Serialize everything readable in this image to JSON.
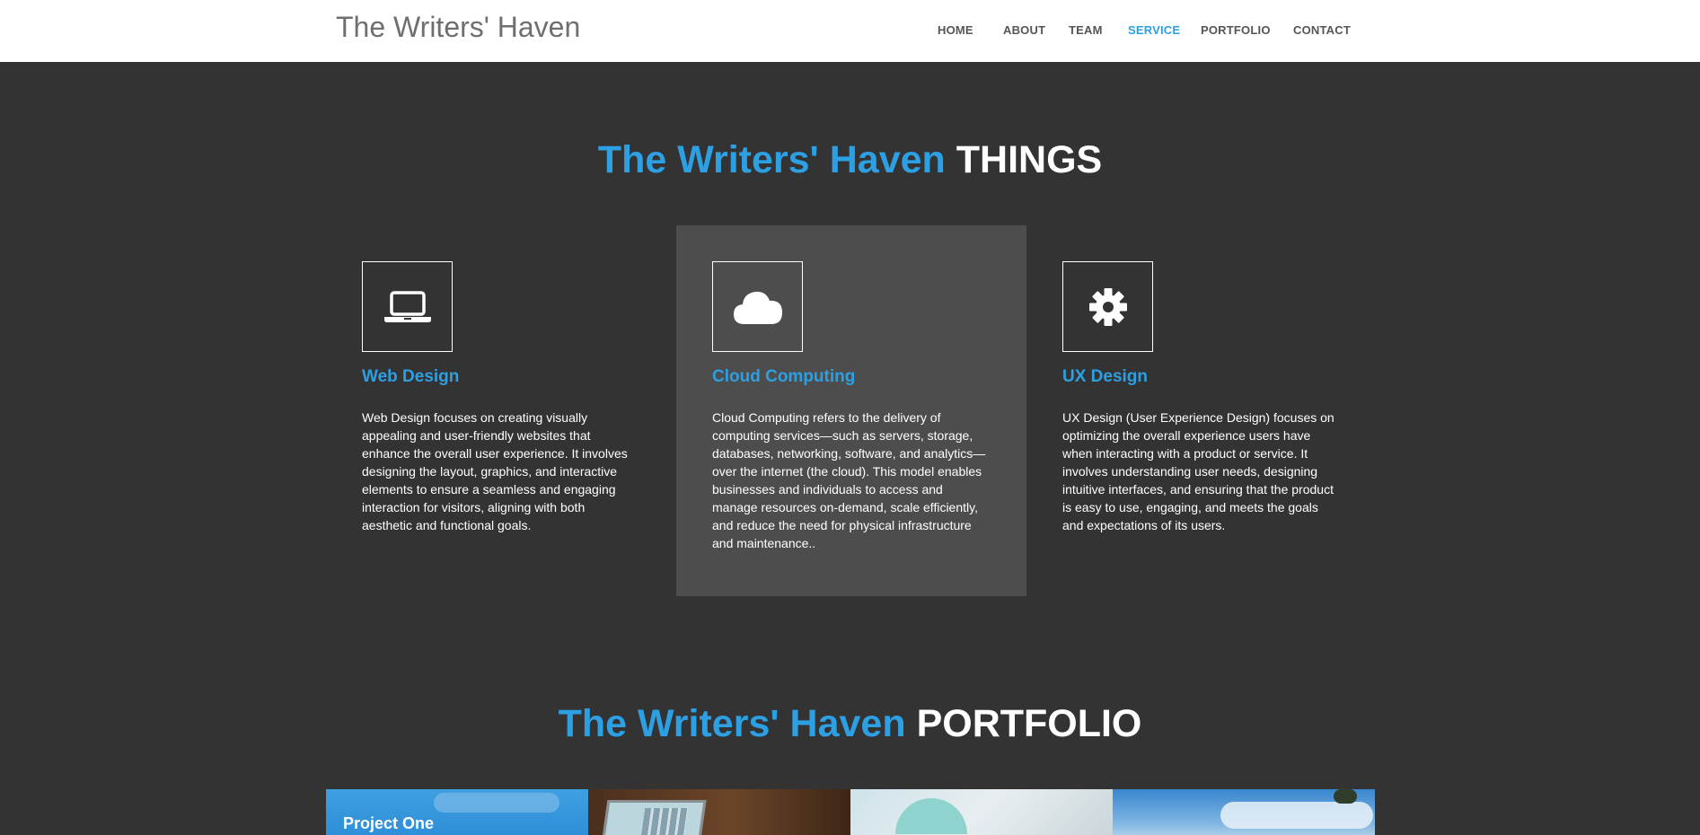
{
  "header": {
    "brand": "The Writers' Haven",
    "nav": [
      {
        "label": "HOME"
      },
      {
        "label": "ABOUT"
      },
      {
        "label": "TEAM"
      },
      {
        "label": "SERVICE",
        "active": true
      },
      {
        "label": "PORTFOLIO"
      },
      {
        "label": "CONTACT"
      }
    ]
  },
  "services": {
    "title_accent": "The Writers' Haven",
    "title_rest": "THINGS",
    "items": [
      {
        "icon": "laptop-icon",
        "title": "Web Design",
        "text": "Web Design focuses on creating visually appealing and user-friendly websites that enhance the overall user experience. It involves designing the layout, graphics, and interactive elements to ensure a seamless and engaging interaction for visitors, aligning with both aesthetic and functional goals."
      },
      {
        "icon": "cloud-icon",
        "title": "Cloud Computing",
        "text": "Cloud Computing refers to the delivery of computing services—such as servers, storage, databases, networking, software, and analytics—over the internet (the cloud). This model enables businesses and individuals to access and manage resources on-demand, scale efficiently, and reduce the need for physical infrastructure and maintenance.."
      },
      {
        "icon": "gear-icon",
        "title": "UX Design",
        "text": "UX Design (User Experience Design) focuses on optimizing the overall experience users have when interacting with a product or service. It involves understanding user needs, designing intuitive interfaces, and ensuring that the product is easy to use, engaging, and meets the goals and expectations of its users."
      }
    ]
  },
  "portfolio": {
    "title_accent": "The Writers' Haven",
    "title_rest": "PORTFOLIO",
    "items": [
      {
        "label": "Project One"
      },
      {
        "label": ""
      },
      {
        "label": ""
      },
      {
        "label": ""
      }
    ]
  },
  "colors": {
    "accent": "#2d9fe3",
    "background": "#333333",
    "highlight_card": "#4d4d4d",
    "header_bg": "#ffffff"
  }
}
